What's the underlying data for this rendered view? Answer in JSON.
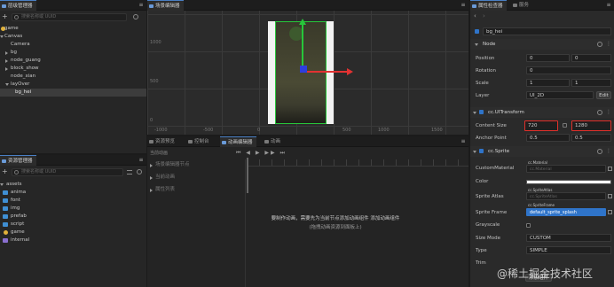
{
  "hierarchy": {
    "tab": "层级管理器",
    "search_placeholder": "搜索名称或 UUID",
    "tree": [
      "game",
      "Canvas",
      "Camera",
      "bg",
      "node_guang",
      "block_show",
      "node_xian",
      "layOver",
      "bg_hei"
    ]
  },
  "assets": {
    "tab": "资源管理器",
    "search_placeholder": "搜索名称或 UUID",
    "tree": [
      "assets",
      "anima",
      "font",
      "img",
      "prefab",
      "script",
      "game",
      "internal"
    ]
  },
  "scene": {
    "tab": "场景编辑器",
    "mode_label": "2D",
    "axis_labels": [
      "1000",
      "500",
      "0"
    ],
    "ruler_labels": [
      "-1000",
      "-500",
      "0",
      "500",
      "1000",
      "1500"
    ]
  },
  "bottom_tabs": [
    "资源预览",
    "控制台",
    "动画编辑器",
    "动画"
  ],
  "animation": {
    "clip_label": "当前动画",
    "rows": [
      "场景编辑器节点",
      "当前动画",
      "属性列表"
    ],
    "message_line1": "要制作动画，需要先为当前节点添加动画组件 添加动画组件",
    "message_line2": "(拖拽动画资源到面板上)",
    "message_link": "添加动画组件"
  },
  "inspector": {
    "tabs": [
      "属性检查器",
      "服务"
    ],
    "node_name": "bg_hei",
    "node_section": "Node",
    "position": {
      "label": "Position",
      "x": "0",
      "y": "0"
    },
    "rotation": {
      "label": "Rotation",
      "z": "0"
    },
    "scale": {
      "label": "Scale",
      "x": "1",
      "y": "1"
    },
    "layer": {
      "label": "Layer",
      "value": "UI_2D",
      "edit": "Edit"
    },
    "uitransform": {
      "section": "cc.UITransform",
      "content_size_label": "Content Size",
      "width": "720",
      "height": "1280",
      "anchor_label": "Anchor Point",
      "ax": "0.5",
      "ay": "0.5"
    },
    "sprite": {
      "section": "cc.Sprite",
      "custom_material_label": "CustomMaterial",
      "custom_material_tag": "cc.Material",
      "custom_material_value": "cc.Material",
      "color_label": "Color",
      "atlas_label": "Sprite Atlas",
      "atlas_tag": "cc.SpriteAtlas",
      "atlas_value": "cc.SpriteAtlas",
      "frame_label": "Sprite Frame",
      "frame_tag": "cc.SpriteFrame",
      "frame_value": "default_sprite_splash",
      "grayscale_label": "Grayscale",
      "size_mode_label": "Size Mode",
      "size_mode_value": "CUSTOM",
      "type_label": "Type",
      "type_value": "SIMPLE",
      "trim_label": "Trim"
    },
    "add_component": "添加组件"
  },
  "watermark": "@稀土掘金技术社区",
  "colors": {
    "accent": "#2f74c9",
    "highlight_red": "#e0302a",
    "gizmo_green": "#27c63a",
    "gizmo_red": "#e23232",
    "gizmo_blue": "#2e3ee0"
  }
}
